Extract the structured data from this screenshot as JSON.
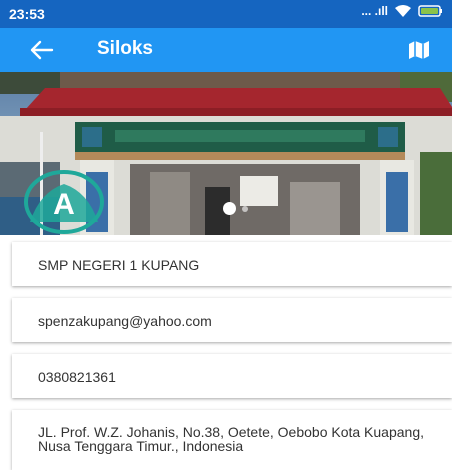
{
  "status_bar": {
    "time": "23:53",
    "signal_text": "... .ıll"
  },
  "app_bar": {
    "title": "Siloks",
    "back_icon": "arrow-left-icon",
    "map_icon": "map-icon"
  },
  "hero": {
    "logo_letter": "A",
    "slide_count": 2,
    "active_slide": 1
  },
  "details": {
    "name": "SMP NEGERI 1 KUPANG",
    "email": "spenzakupang@yahoo.com",
    "phone": "0380821361",
    "address": "JL. Prof. W.Z. Johanis, No.38, Oetete, Oebobo Kota Kuapang, Nusa Tenggara Timur., Indonesia"
  },
  "colors": {
    "status_bar": "#1565c0",
    "app_bar": "#2196f3",
    "roof": "#a5262e",
    "logo": "#1fa89a"
  }
}
